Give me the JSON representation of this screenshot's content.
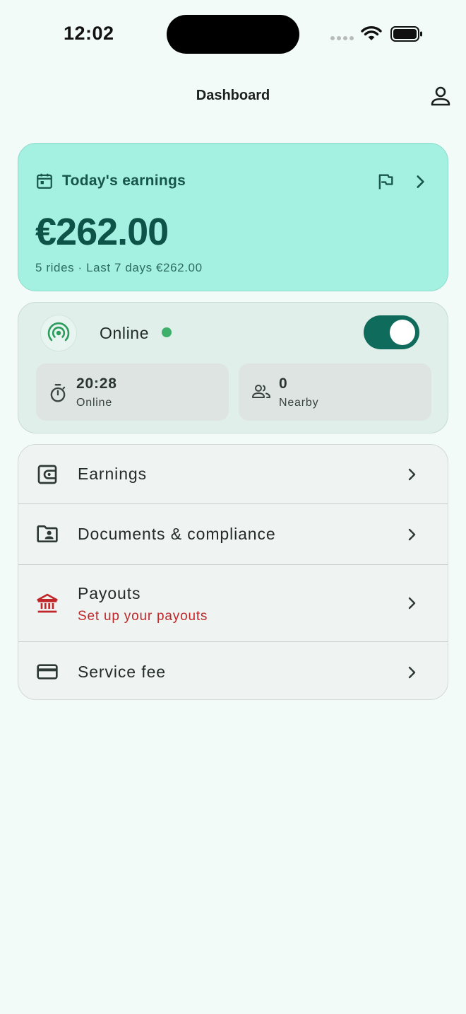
{
  "status_bar": {
    "time": "12:02"
  },
  "header": {
    "title": "Dashboard"
  },
  "earnings_card": {
    "title": "Today's earnings",
    "amount": "€262.00",
    "subtitle": "5 rides · Last 7 days €262.00"
  },
  "online_card": {
    "status_label": "Online",
    "toggle_on": true,
    "stats": [
      {
        "value": "20:28",
        "label": "Online",
        "icon": "timer-icon"
      },
      {
        "value": "0",
        "label": "Nearby",
        "icon": "people-icon"
      }
    ]
  },
  "menu": {
    "items": [
      {
        "label": "Earnings",
        "icon": "wallet-icon"
      },
      {
        "label": "Documents & compliance",
        "icon": "folder-account-icon"
      },
      {
        "label": "Payouts",
        "sublabel": "Set up your payouts",
        "icon": "bank-icon"
      },
      {
        "label": "Service fee",
        "icon": "credit-card-icon"
      }
    ]
  },
  "colors": {
    "accent": "#0f6b5c",
    "earnings_bg": "#a4f0e1",
    "online_dot": "#3fb06c",
    "warning": "#c0262a"
  }
}
